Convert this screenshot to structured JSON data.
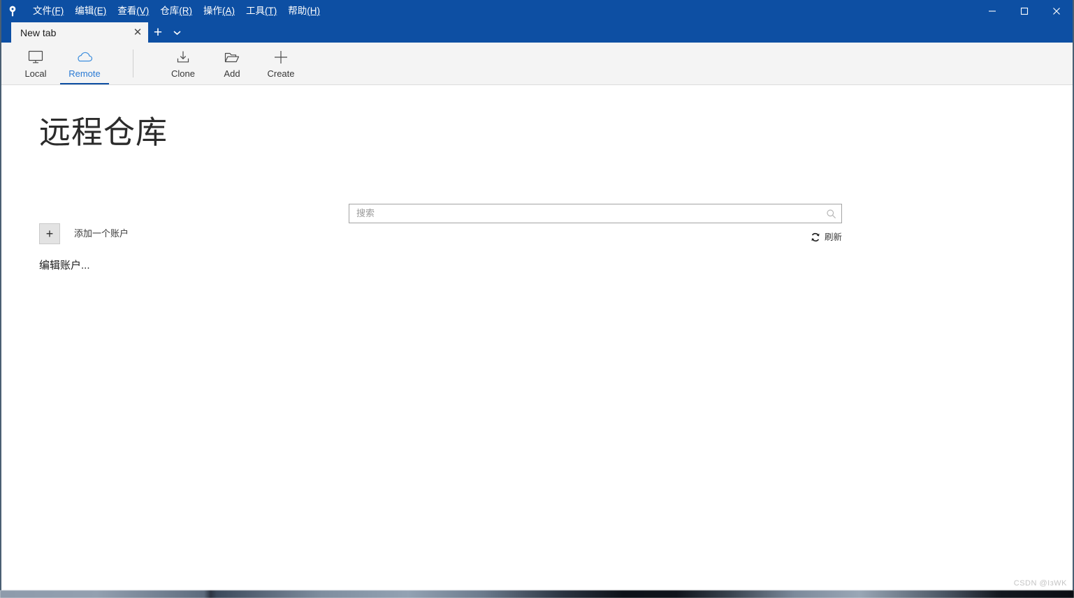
{
  "window": {
    "logo_icon": "gitext-pin-logo-icon",
    "controls": {
      "minimize": "minimize-icon",
      "maximize": "maximize-icon",
      "close": "close-icon"
    }
  },
  "menu": {
    "items": [
      {
        "label": "文件",
        "accel": "(F)"
      },
      {
        "label": "编辑",
        "accel": "(E)"
      },
      {
        "label": "查看",
        "accel": "(V)"
      },
      {
        "label": "仓库",
        "accel": "(R)"
      },
      {
        "label": "操作",
        "accel": "(A)"
      },
      {
        "label": "工具",
        "accel": "(T)"
      },
      {
        "label": "帮助",
        "accel": "(H)"
      }
    ]
  },
  "tabs": {
    "active_title": "New tab",
    "close_glyph": "✕",
    "new_tab_glyph": "+",
    "list_glyph": "▾"
  },
  "toolbar": {
    "items": [
      {
        "label": "Local",
        "icon": "monitor-icon",
        "active": false
      },
      {
        "label": "Remote",
        "icon": "cloud-icon",
        "active": true
      },
      {
        "label": "Clone",
        "icon": "download-icon",
        "active": false
      },
      {
        "label": "Add",
        "icon": "folder-open-icon",
        "active": false
      },
      {
        "label": "Create",
        "icon": "plus-icon",
        "active": false
      }
    ]
  },
  "main": {
    "page_title": "远程仓库",
    "add_account": {
      "button_glyph": "+",
      "label": "添加一个账户"
    },
    "edit_accounts_link": "编辑账户...",
    "search": {
      "value": "",
      "placeholder": "搜索",
      "icon": "search-icon"
    },
    "refresh": {
      "label": "刷新",
      "icon": "refresh-icon"
    }
  },
  "watermark": "CSDN @ІзWK",
  "colors": {
    "title_bar": "#0d4fa3",
    "accent": "#2a7ad4",
    "toolbar_bg": "#f4f4f4",
    "content_bg": "#ffffff",
    "border": "#4a5f73"
  }
}
